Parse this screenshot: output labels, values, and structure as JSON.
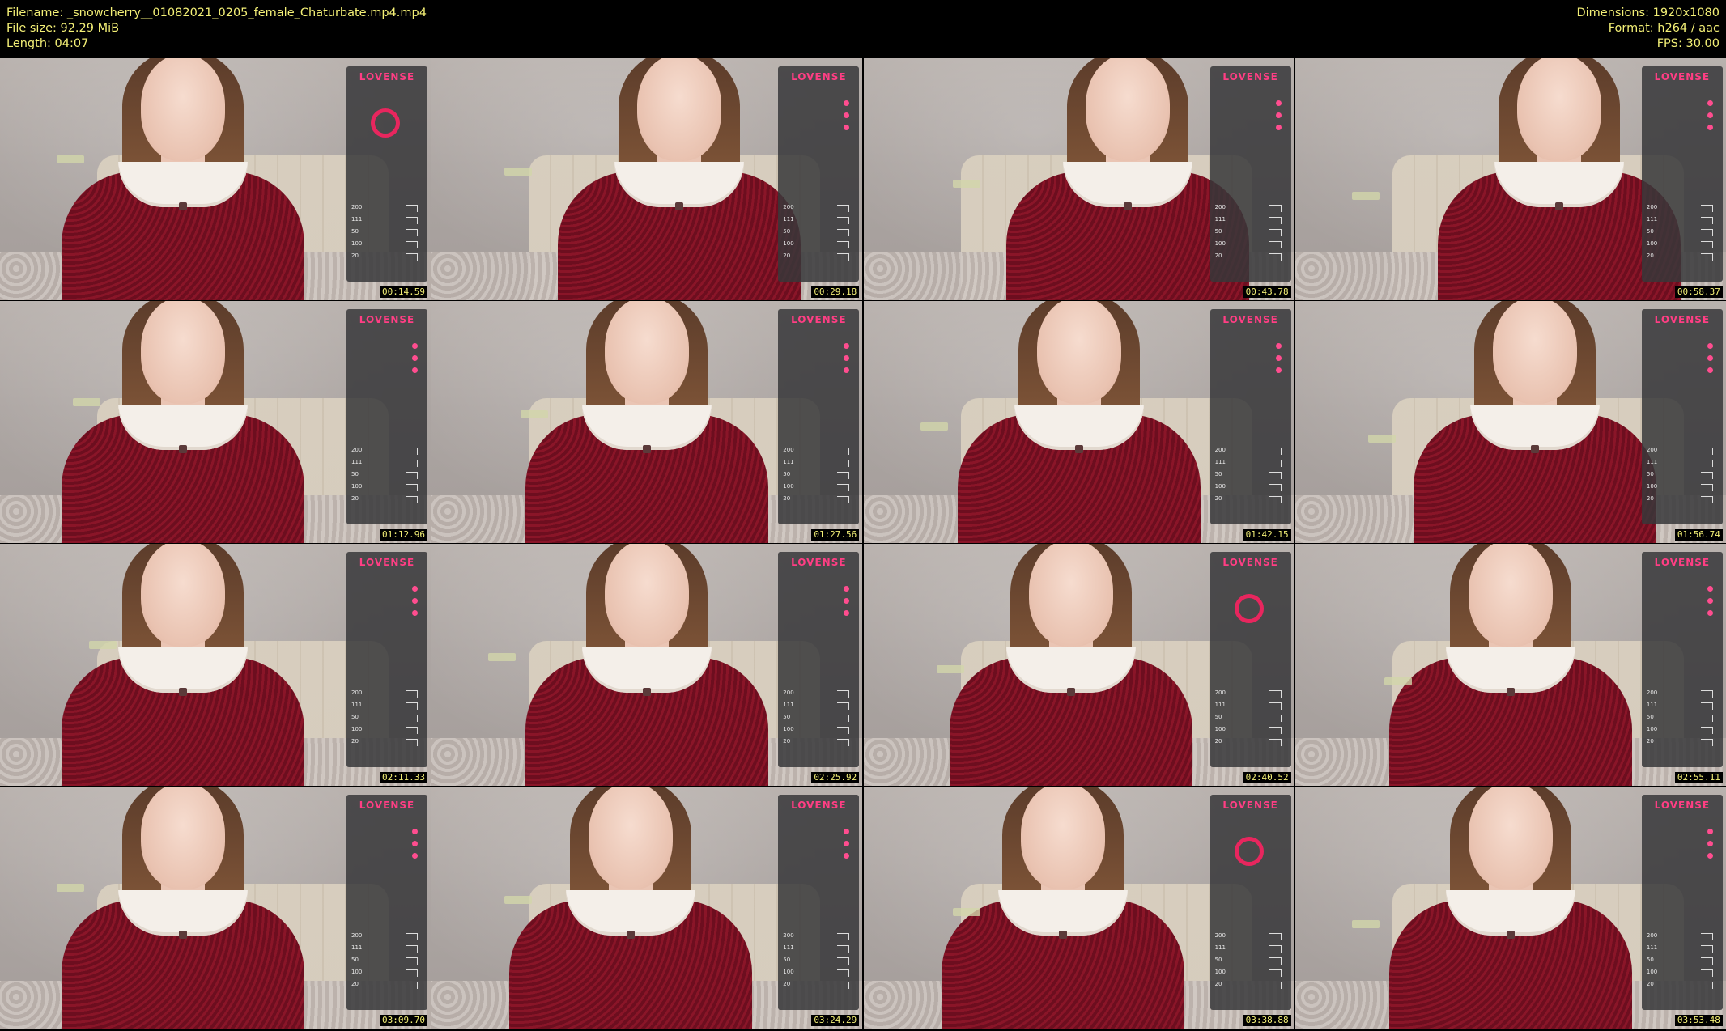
{
  "header": {
    "filename": "Filename: _snowcherry__01082021_0205_female_Chaturbate.mp4.mp4",
    "filesize": "File size: 92.29 MiB",
    "length": "Length: 04:07",
    "dimensions": "Dimensions: 1920x1080",
    "format": "Format: h264 / aac",
    "fps": "FPS: 30.00"
  },
  "colors": {
    "meta_text": "#f3ef76",
    "lovense_pink": "#ff3e84",
    "dress": "#7a1224"
  },
  "thumbnails": [
    {
      "timestamp": "00:14.59"
    },
    {
      "timestamp": "00:29.18"
    },
    {
      "timestamp": "00:43.78"
    },
    {
      "timestamp": "00:58.37"
    },
    {
      "timestamp": "01:12.96"
    },
    {
      "timestamp": "01:27.56"
    },
    {
      "timestamp": "01:42.15"
    },
    {
      "timestamp": "01:56.74"
    },
    {
      "timestamp": "02:11.33"
    },
    {
      "timestamp": "02:25.92"
    },
    {
      "timestamp": "02:40.52"
    },
    {
      "timestamp": "02:55.11"
    },
    {
      "timestamp": "03:09.70"
    },
    {
      "timestamp": "03:24.29"
    },
    {
      "timestamp": "03:38.88"
    },
    {
      "timestamp": "03:53.48"
    }
  ],
  "lovense": {
    "logo": "LOVENSE",
    "levels": [
      "200",
      "111",
      "50",
      "100",
      "20"
    ]
  }
}
